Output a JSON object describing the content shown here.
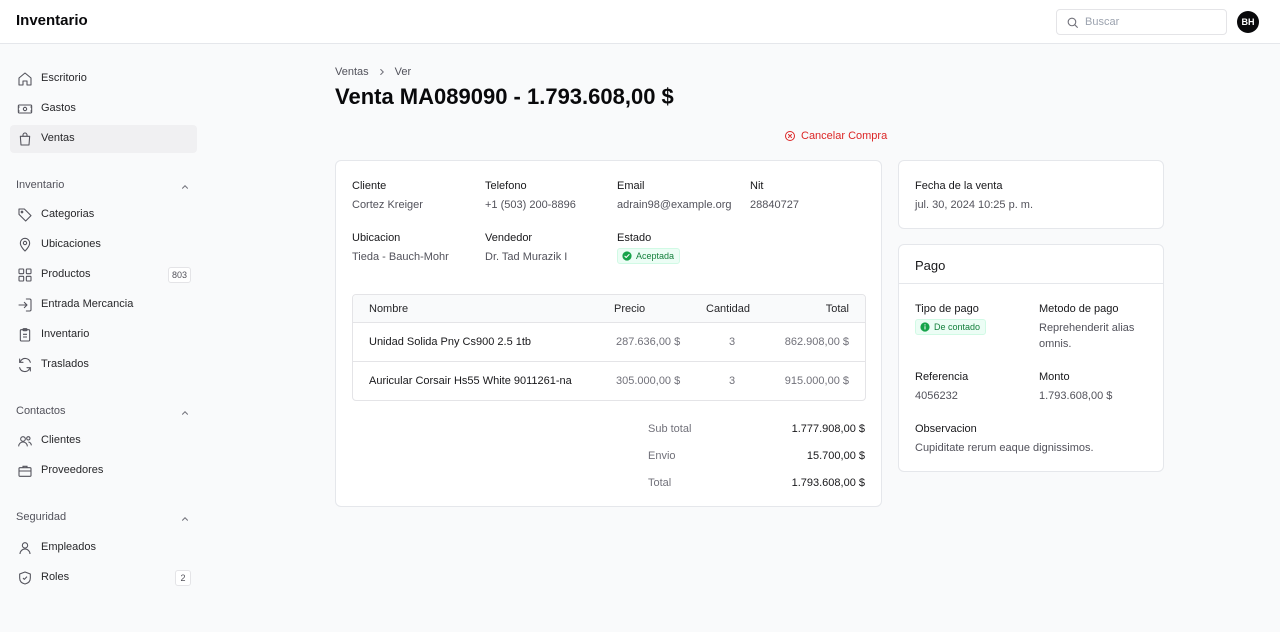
{
  "app": {
    "title": "Inventario",
    "user_initials": "BH"
  },
  "search": {
    "placeholder": "Buscar",
    "value": ""
  },
  "sidebar": {
    "items_top": [
      {
        "label": "Escritorio",
        "icon": "home-icon"
      },
      {
        "label": "Gastos",
        "icon": "banknote-icon"
      },
      {
        "label": "Ventas",
        "icon": "shopping-bag-icon",
        "active": true
      }
    ],
    "groups": [
      {
        "label": "Inventario",
        "items": [
          {
            "label": "Categorias",
            "icon": "tag-icon"
          },
          {
            "label": "Ubicaciones",
            "icon": "map-pin-icon"
          },
          {
            "label": "Productos",
            "icon": "grid-icon",
            "badge": "803"
          },
          {
            "label": "Entrada Mercancia",
            "icon": "log-in-icon"
          },
          {
            "label": "Inventario",
            "icon": "clipboard-icon"
          },
          {
            "label": "Traslados",
            "icon": "refresh-icon"
          }
        ]
      },
      {
        "label": "Contactos",
        "items": [
          {
            "label": "Clientes",
            "icon": "users-icon"
          },
          {
            "label": "Proveedores",
            "icon": "briefcase-icon"
          }
        ]
      },
      {
        "label": "Seguridad",
        "items": [
          {
            "label": "Empleados",
            "icon": "user-icon"
          },
          {
            "label": "Roles",
            "icon": "shield-icon",
            "badge": "2"
          }
        ]
      }
    ]
  },
  "breadcrumb": {
    "parent": "Ventas",
    "current": "Ver"
  },
  "page": {
    "title": "Venta MA089090 - 1.793.608,00 $",
    "cancel_label": "Cancelar Compra"
  },
  "sale": {
    "cliente": {
      "label": "Cliente",
      "value": "Cortez Kreiger"
    },
    "telefono": {
      "label": "Telefono",
      "value": "+1 (503) 200-8896"
    },
    "email": {
      "label": "Email",
      "value": "adrain98@example.org"
    },
    "nit": {
      "label": "Nit",
      "value": "28840727"
    },
    "ubicacion": {
      "label": "Ubicacion",
      "value": "Tieda - Bauch-Mohr"
    },
    "vendedor": {
      "label": "Vendedor",
      "value": "Dr. Tad Murazik I"
    },
    "estado": {
      "label": "Estado",
      "value": "Aceptada"
    }
  },
  "items_table": {
    "headers": {
      "nombre": "Nombre",
      "precio": "Precio",
      "cantidad": "Cantidad",
      "total": "Total"
    },
    "rows": [
      {
        "nombre": "Unidad Solida Pny Cs900 2.5 1tb",
        "precio": "287.636,00 $",
        "cantidad": "3",
        "total": "862.908,00 $"
      },
      {
        "nombre": "Auricular Corsair Hs55 White 9011261-na",
        "precio": "305.000,00 $",
        "cantidad": "3",
        "total": "915.000,00 $"
      }
    ]
  },
  "totals": {
    "subtotal": {
      "label": "Sub total",
      "value": "1.777.908,00 $"
    },
    "envio": {
      "label": "Envio",
      "value": "15.700,00 $"
    },
    "total": {
      "label": "Total",
      "value": "1.793.608,00 $"
    }
  },
  "fecha": {
    "label": "Fecha de la venta",
    "value": "jul. 30, 2024 10:25 p. m."
  },
  "pago": {
    "title": "Pago",
    "tipo": {
      "label": "Tipo de pago",
      "value": "De contado"
    },
    "metodo": {
      "label": "Metodo de pago",
      "value_line1": "Reprehenderit alias",
      "value_line2": "omnis."
    },
    "referencia": {
      "label": "Referencia",
      "value": "4056232"
    },
    "monto": {
      "label": "Monto",
      "value": "1.793.608,00 $"
    },
    "observacion": {
      "label": "Observacion",
      "value": "Cupiditate rerum eaque dignissimos."
    }
  },
  "colors": {
    "accent_danger": "#dc2626",
    "success": "#16a34a",
    "text": "#18181b",
    "muted": "#71717a"
  }
}
